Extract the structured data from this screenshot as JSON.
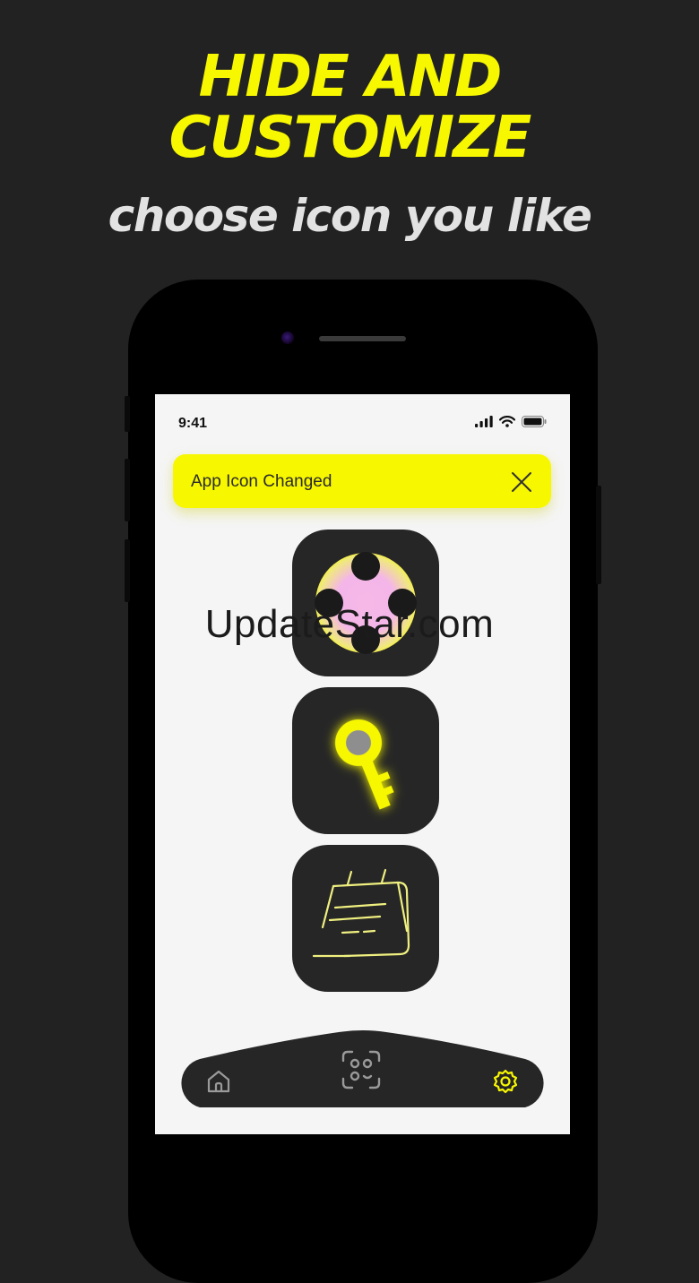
{
  "hero": {
    "headline_line1": "HIDE AND",
    "headline_line2": "CUSTOMIZE",
    "subheadline": "choose icon you like"
  },
  "status_bar": {
    "time": "9:41"
  },
  "toast": {
    "message": "App Icon Changed",
    "close_icon": "close-icon"
  },
  "icon_options": [
    {
      "name": "dots-disc-icon"
    },
    {
      "name": "key-icon"
    },
    {
      "name": "calendar-icon"
    }
  ],
  "watermark": "UpdateStar.com",
  "tab_bar": {
    "items": [
      {
        "icon": "home-icon",
        "active": false
      },
      {
        "icon": "face-scan-icon",
        "active": false
      },
      {
        "icon": "settings-icon",
        "active": true
      }
    ]
  },
  "colors": {
    "background": "#222222",
    "accent": "#F7F700",
    "phone_body": "#000000",
    "screen": "#F5F5F5",
    "icon_tile": "#262626"
  }
}
